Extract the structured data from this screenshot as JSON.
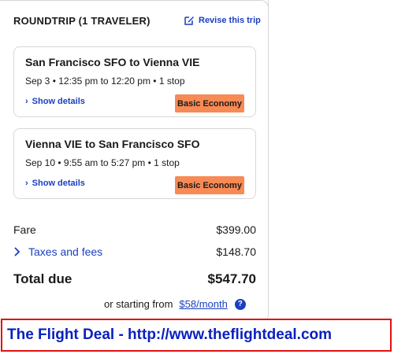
{
  "header": {
    "trip_title": "ROUNDTRIP (1 TRAVELER)",
    "revise_label": "Revise this trip"
  },
  "legs": [
    {
      "route": "San Francisco SFO to Vienna VIE",
      "time": "Sep 3 • 12:35 pm to 12:20 pm • 1 stop",
      "details_label": "Show details",
      "fare_class": "Basic Economy"
    },
    {
      "route": "Vienna VIE to San Francisco SFO",
      "time": "Sep 10 • 9:55 am to 5:27 pm • 1 stop",
      "details_label": "Show details",
      "fare_class": "Basic Economy"
    }
  ],
  "pricing": {
    "fare_label": "Fare",
    "fare_value": "$399.00",
    "taxes_label": "Taxes and fees",
    "taxes_value": "$148.70",
    "total_label": "Total due",
    "total_value": "$547.70",
    "starting_text": "or starting from",
    "monthly_link": "$58/month",
    "help_glyph": "?"
  },
  "banner": {
    "text": "The Flight Deal - http://www.theflightdeal.com"
  },
  "colors": {
    "link": "#1a3fc0",
    "badge": "#f78a55",
    "banner_border": "#e01010",
    "banner_text": "#0a1fbf"
  }
}
